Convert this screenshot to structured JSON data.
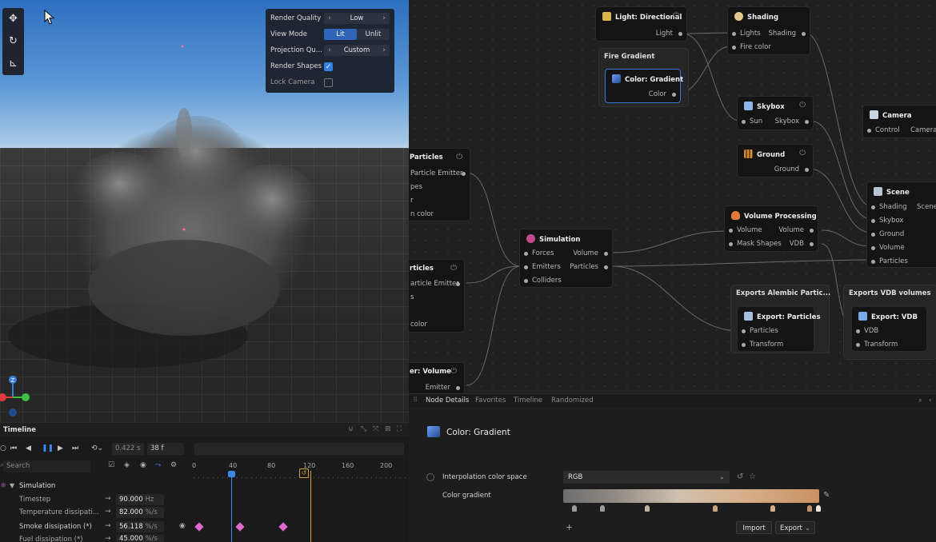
{
  "viewport": {
    "render_panel": {
      "render_quality_label": "Render Quality",
      "render_quality_value": "Low",
      "view_mode_label": "View Mode",
      "view_mode_options": [
        "Lit",
        "Unlit"
      ],
      "view_mode_selected": "Lit",
      "projection_label": "Projection Qu...",
      "projection_value": "Custom",
      "render_shapes_label": "Render Shapes",
      "render_shapes_checked": true,
      "lock_camera_label": "Lock Camera",
      "lock_camera_checked": false
    },
    "tools": [
      "move-icon",
      "rotate-icon",
      "scale-icon"
    ],
    "gizmo_axis_label": "Z"
  },
  "graph": {
    "nodes": {
      "light_directional": {
        "title": "Light: Directional",
        "out": "Light"
      },
      "shading": {
        "title": "Shading",
        "in": [
          "Lights",
          "Fire color"
        ],
        "out": "Shading"
      },
      "fire_gradient_group": {
        "title": "Fire Gradient"
      },
      "color_gradient": {
        "title": "Color: Gradient",
        "out": "Color"
      },
      "skybox": {
        "title": "Skybox",
        "in": "Sun",
        "out": "Skybox"
      },
      "ground": {
        "title": "Ground",
        "out": "Ground"
      },
      "camera": {
        "title": "Camera",
        "in": "Control",
        "out": "Camera"
      },
      "scene": {
        "title": "Scene",
        "in": [
          "Shading",
          "Skybox",
          "Ground",
          "Volume",
          "Particles"
        ],
        "out": "Scene"
      },
      "particles_1": {
        "title": "Particles",
        "rows": [
          "Particle Emitter",
          "pes",
          "r",
          "n color"
        ]
      },
      "particles_2": {
        "title": "rticles",
        "rows": [
          "article Emitter",
          "s",
          "",
          "color"
        ]
      },
      "emitter_volume": {
        "title": "er: Volume",
        "out": "Emitter"
      },
      "simulation": {
        "title": "Simulation",
        "in": [
          "Forces",
          "Emitters",
          "Colliders"
        ],
        "out": [
          "Volume",
          "Particles"
        ]
      },
      "volume_processing": {
        "title": "Volume Processing",
        "in": [
          "Volume",
          "Mask Shapes"
        ],
        "out": [
          "Volume",
          "VDB"
        ]
      },
      "exports_alembic_group": {
        "title": "Exports Alembic Partic..."
      },
      "export_particles": {
        "title": "Export: Particles",
        "in": [
          "Particles",
          "Transform"
        ]
      },
      "exports_vdb_group": {
        "title": "Exports VDB volumes"
      },
      "export_vdb": {
        "title": "Export: VDB",
        "in": [
          "VDB",
          "Transform"
        ]
      }
    }
  },
  "details": {
    "tabs": [
      "Node Details",
      "Favorites",
      "Timeline",
      "Randomized"
    ],
    "active_tab": "Node Details",
    "node_title": "Color: Gradient",
    "interp_label": "Interpolation color space",
    "interp_value": "RGB",
    "gradient_label": "Color gradient",
    "import_label": "Import",
    "export_label": "Export",
    "add_label": "+"
  },
  "timeline": {
    "title": "Timeline",
    "time_value": "0.422 s",
    "frame_value": "38 f",
    "search_placeholder": "Search",
    "group_label": "Simulation",
    "ruler": [
      "0",
      "40",
      "80",
      "120",
      "160",
      "200"
    ],
    "rows": [
      {
        "label": "Timestep",
        "value": "90.000",
        "unit": "Hz"
      },
      {
        "label": "Temperature dissipati...",
        "value": "82.000",
        "unit": "%/s"
      },
      {
        "label": "Smoke dissipation (*)",
        "value": "56.118",
        "unit": "%/s"
      },
      {
        "label": "Fuel dissipation (*)",
        "value": "45.000",
        "unit": "%/s"
      }
    ]
  }
}
